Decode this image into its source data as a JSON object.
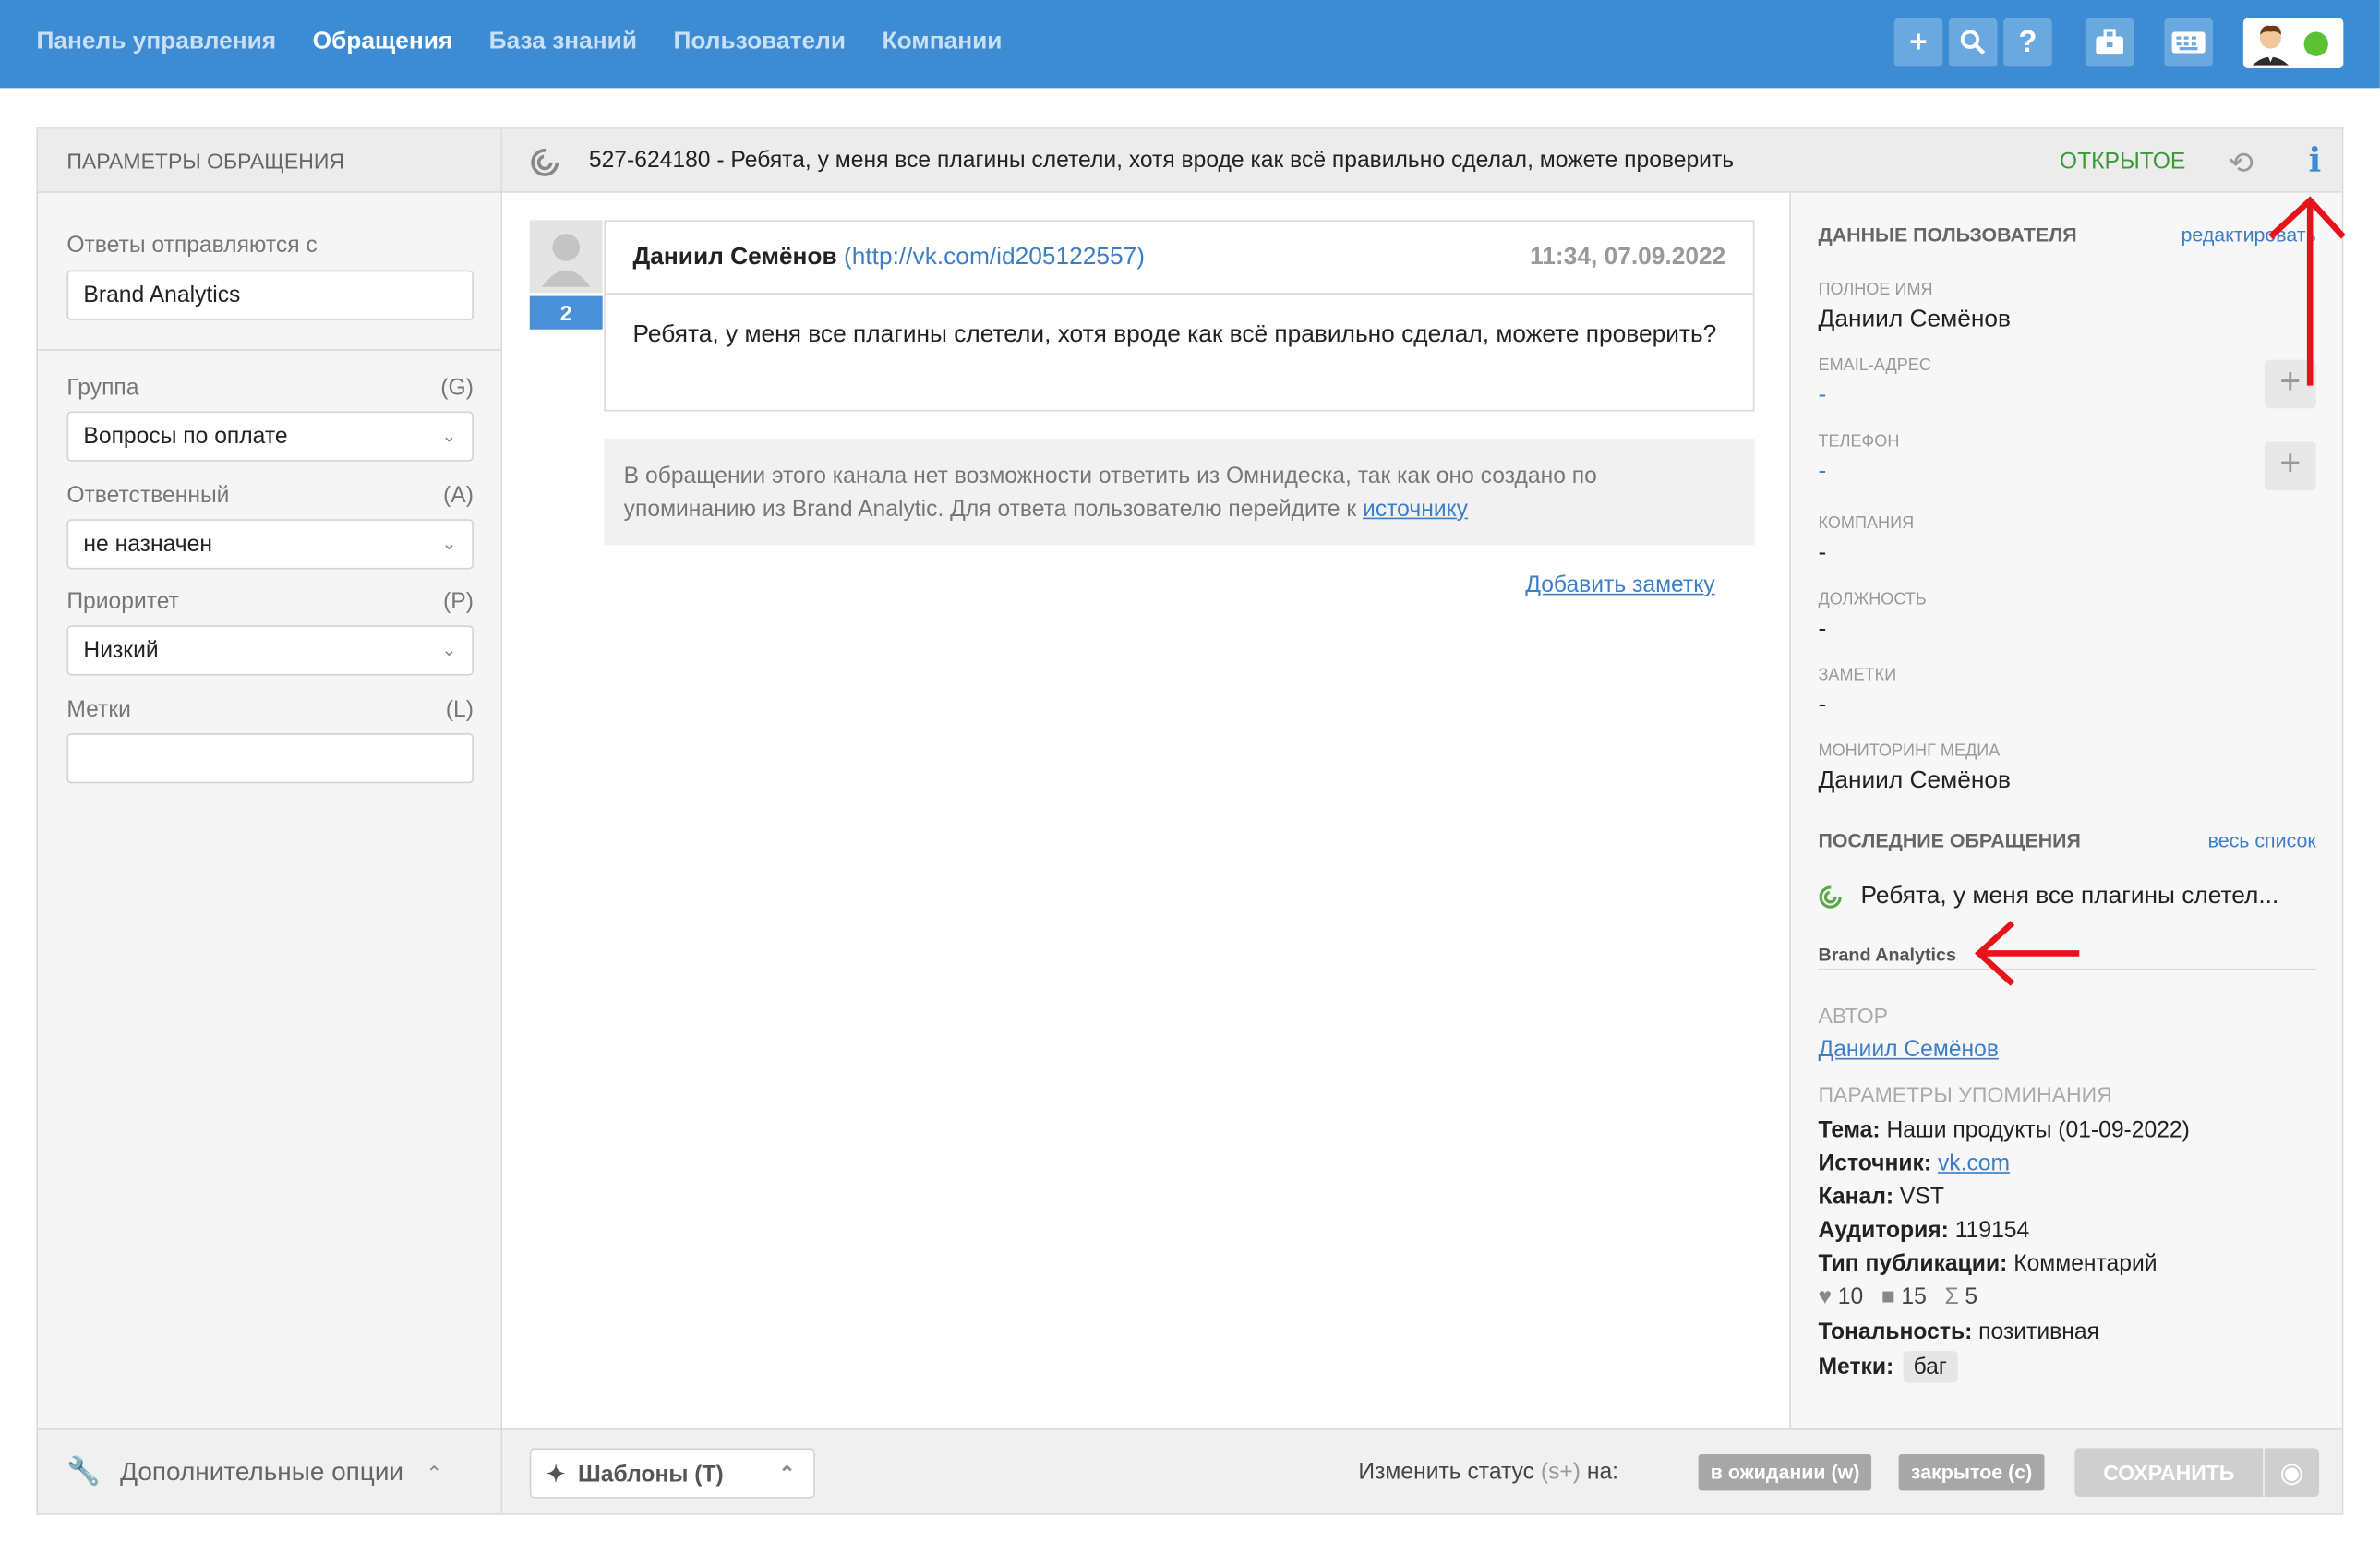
{
  "nav": {
    "items": [
      "Панель управления",
      "Обращения",
      "База знаний",
      "Пользователи",
      "Компании"
    ],
    "active_index": 1
  },
  "toolbar_icons": [
    "plus-icon",
    "search-icon",
    "help-icon",
    "briefcase-icon",
    "keyboard-icon"
  ],
  "left_panel": {
    "title": "ПАРАМЕТРЫ ОБРАЩЕНИЯ",
    "replies_from_label": "Ответы отправляются с",
    "replies_from_value": "Brand Analytics",
    "group_label": "Группа",
    "group_hotkey": "(G)",
    "group_value": "Вопросы по оплате",
    "assignee_label": "Ответственный",
    "assignee_hotkey": "(A)",
    "assignee_value": "не назначен",
    "priority_label": "Приоритет",
    "priority_hotkey": "(P)",
    "priority_value": "Низкий",
    "labels_label": "Метки",
    "labels_hotkey": "(L)",
    "labels_value": "",
    "extra_options": "Дополнительные опции"
  },
  "ticket": {
    "subject": "527-624180 - Ребята, у меня все плагины слетели, хотя вроде как всё правильно сделал, можете проверить",
    "status": "ОТКРЫТОЕ"
  },
  "message": {
    "author": "Даниил Семёнов",
    "author_link": "(http://vk.com/id205122557)",
    "time": "11:34, 07.09.2022",
    "count": "2",
    "body": "Ребята, у меня все плагины слетели, хотя вроде как всё правильно сделал, можете проверить?"
  },
  "notice": {
    "text": "В обращении этого канала нет возможности ответить из Омнидеска, так как оно создано по упоминанию из Brand Analytic. Для ответа пользователю перейдите к ",
    "link": "источнику"
  },
  "add_note": "Добавить заметку",
  "bottom": {
    "templates": "Шаблоны (T)",
    "change_status_prefix": "Изменить статус",
    "change_status_hotkey": "(s+)",
    "change_status_suffix": "на:",
    "status_waiting": "в ожидании (w)",
    "status_closed": "закрытое (c)",
    "save": "СОХРАНИТЬ"
  },
  "user_panel": {
    "title": "ДАННЫЕ ПОЛЬЗОВАТЕЛЯ",
    "edit": "редактировать",
    "full_name_label": "ПОЛНОЕ ИМЯ",
    "full_name": "Даниил Семёнов",
    "email_label": "EMAIL-АДРЕС",
    "email": "-",
    "phone_label": "ТЕЛЕФОН",
    "phone": "-",
    "company_label": "КОМПАНИЯ",
    "company": "-",
    "position_label": "ДОЛЖНОСТЬ",
    "position": "-",
    "notes_label": "ЗАМЕТКИ",
    "notes": "-",
    "media_label": "МОНИТОРИНГ МЕДИА",
    "media": "Даниил Семёнов",
    "recent_title": "ПОСЛЕДНИЕ ОБРАЩЕНИЯ",
    "all_list": "весь список",
    "recent_item": "Ребята, у меня все плагины слетел...",
    "brand_analytics": "Brand Analytics",
    "author_title": "АВТОР",
    "author_link": "Даниил Семёнов",
    "mention_title": "ПАРАМЕТРЫ УПОМИНАНИЯ",
    "theme_label": "Тема:",
    "theme_value": "Наши продукты (01-09-2022)",
    "source_label": "Источник:",
    "source_value": "vk.com",
    "channel_label": "Канал:",
    "channel_value": "VST",
    "audience_label": "Аудитория:",
    "audience_value": "119154",
    "pub_type_label": "Тип публикации:",
    "pub_type_value": "Комментарий",
    "likes": "10",
    "comments": "15",
    "total": "5",
    "tonality_label": "Тональность:",
    "tonality_value": "позитивная",
    "tags_label": "Метки:",
    "tag_value": "баг"
  },
  "colors": {
    "topbar": "#3d8bd3",
    "status_open": "#3a9a3a",
    "link": "#3d7ec7",
    "annotation_arrow": "#e8121b"
  }
}
